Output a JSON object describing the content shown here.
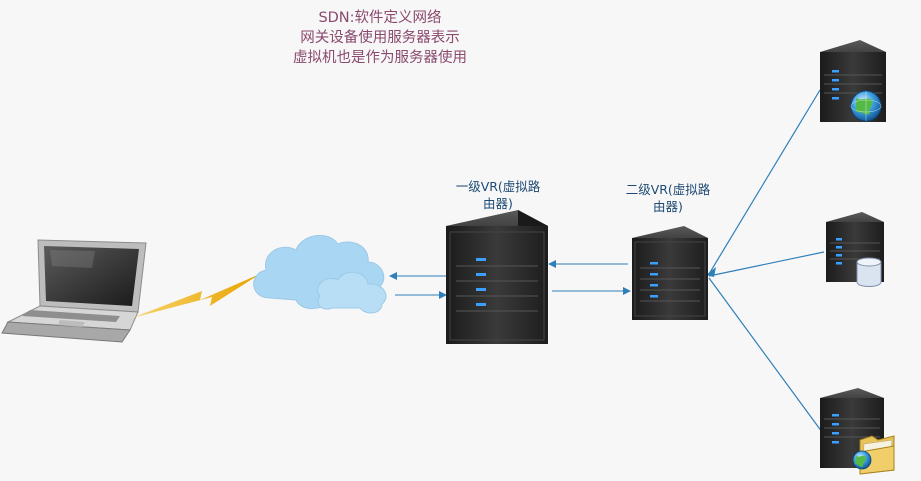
{
  "note": {
    "lines": [
      "SDN:软件定义网络",
      "网关设备使用服务器表示",
      "虚拟机也是作为服务器使用"
    ]
  },
  "nodes": {
    "vr1": {
      "label_line1": "一级VR(虚拟路",
      "label_line2": "由器)"
    },
    "vr2": {
      "label_line1": "二级VR(虚拟路",
      "label_line2": "由器)"
    }
  },
  "icons": {
    "laptop": "laptop-icon",
    "lightning": "lightning-icon",
    "cloud": "cloud-icon",
    "server_vr1": "server-icon",
    "server_vr2": "server-icon",
    "server_web": "server-globe-icon",
    "server_db": "server-database-icon",
    "server_file": "server-folder-icon"
  },
  "colors": {
    "note_text": "#8a4a6e",
    "label_text": "#1e4a73",
    "link_line": "#2f7fb8",
    "server_body": "#2d2d2d",
    "server_led": "#3aa0ff",
    "cloud": "#a9d6f2",
    "lightning": "#f2b000"
  }
}
